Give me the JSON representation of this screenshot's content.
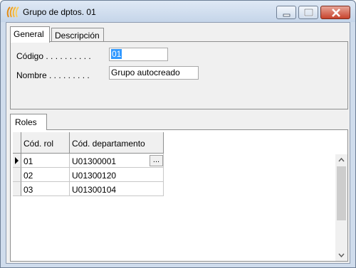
{
  "window": {
    "title": "Grupo de dptos. 01"
  },
  "tabs": [
    {
      "label": "General"
    },
    {
      "label": "Descripción"
    }
  ],
  "form": {
    "codigo_label": "Código . . . . . . . . . .",
    "codigo_value": "01",
    "nombre_label": "Nombre . . . . . . . . .",
    "nombre_value": "Grupo autocreado"
  },
  "roles": {
    "tab_label": "Roles",
    "columns": [
      "Cód. rol",
      "Cód. departamento"
    ],
    "rows": [
      {
        "rol": "01",
        "departamento": "U01300001"
      },
      {
        "rol": "02",
        "departamento": "U01300120"
      },
      {
        "rol": "03",
        "departamento": "U01300104"
      }
    ],
    "ellipsis": "..."
  }
}
